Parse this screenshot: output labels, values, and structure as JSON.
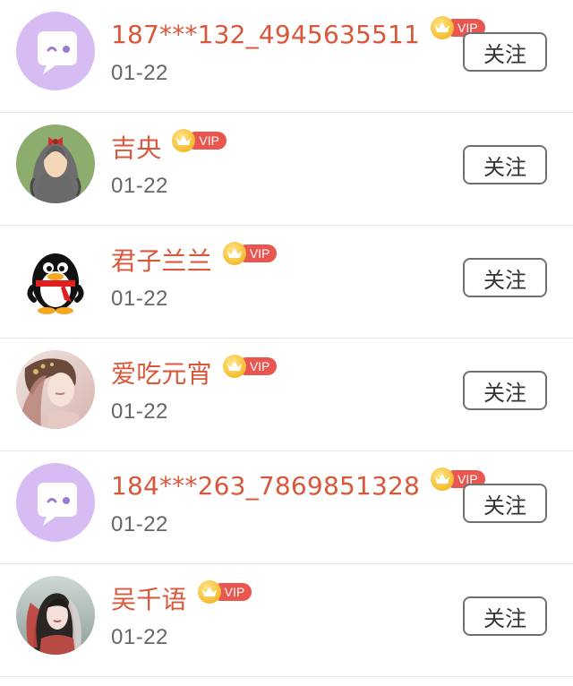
{
  "follow_list": [
    {
      "name": "187***132_4945635511",
      "vip_label": "VIP",
      "date": "01-22",
      "button_label": "关注",
      "avatar": "default-chat-avatar-icon"
    },
    {
      "name": "吉央",
      "vip_label": "VIP",
      "date": "01-22",
      "button_label": "关注",
      "avatar": "girl-with-bow-avatar-icon"
    },
    {
      "name": "君子兰兰",
      "vip_label": "VIP",
      "date": "01-22",
      "button_label": "关注",
      "avatar": "penguin-avatar-icon"
    },
    {
      "name": "爱吃元宵",
      "vip_label": "VIP",
      "date": "01-22",
      "button_label": "关注",
      "avatar": "ancient-girl-photo-avatar-icon"
    },
    {
      "name": "184***263_7869851328",
      "vip_label": "VIP",
      "date": "01-22",
      "button_label": "关注",
      "avatar": "default-chat-avatar-icon"
    },
    {
      "name": "吴千语",
      "vip_label": "VIP",
      "date": "01-22",
      "button_label": "关注",
      "avatar": "hanfu-girl-photo-avatar-icon"
    }
  ],
  "colors": {
    "name": "#d9573a",
    "vip_pill": "#e8564f",
    "vip_crown": "#f7c23c",
    "default_avatar_bg": "#d6bcf3",
    "date": "#666666",
    "divider": "#e6e6e6"
  }
}
